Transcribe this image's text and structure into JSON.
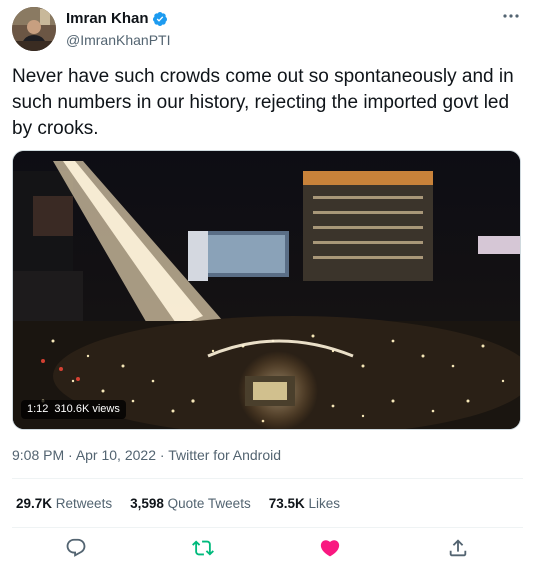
{
  "author": {
    "display_name": "Imran Khan",
    "handle": "@ImranKhanPTI"
  },
  "tweet": {
    "text": "Never have such crowds come out so spontaneously and in such numbers in our history, rejecting the imported govt led by crooks."
  },
  "media": {
    "duration": "1:12",
    "views": "310.6K views"
  },
  "meta": {
    "time": "9:08 PM",
    "date": "Apr 10, 2022",
    "source": "Twitter for Android"
  },
  "stats": {
    "retweets_count": "29.7K",
    "retweets_label": "Retweets",
    "quotes_count": "3,598",
    "quotes_label": "Quote Tweets",
    "likes_count": "73.5K",
    "likes_label": "Likes"
  },
  "colors": {
    "verified": "#1d9bf0",
    "retweet": "#00ba7c",
    "like": "#f91880",
    "secondary_text": "#536471"
  },
  "icons": {
    "reply": "reply-icon",
    "retweet": "retweet-icon",
    "like": "heart-icon",
    "share": "share-icon",
    "more": "more-icon",
    "verified": "verified-badge-icon"
  }
}
